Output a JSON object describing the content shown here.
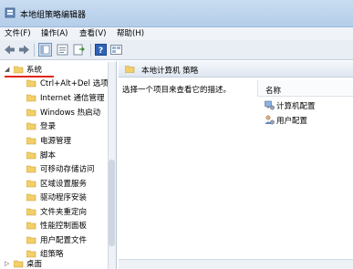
{
  "window": {
    "title": "本地组策略编辑器"
  },
  "menu": {
    "items": [
      "文件(F)",
      "操作(A)",
      "查看(V)",
      "帮助(H)"
    ]
  },
  "tree": {
    "root_label": "系统",
    "children": [
      "Ctrl+Alt+Del 选项",
      "Internet 通信管理",
      "Windows 热启动",
      "登录",
      "电源管理",
      "脚本",
      "可移动存储访问",
      "区域设置服务",
      "驱动程序安装",
      "文件夹重定向",
      "性能控制面板",
      "用户配置文件",
      "组策略"
    ],
    "sibling_label": "桌面"
  },
  "right": {
    "header_title": "本地计算机 策略",
    "description": "选择一个项目来查看它的描述。",
    "column_name": "名称",
    "items": [
      "计算机配置",
      "用户配置"
    ]
  },
  "colors": {
    "accent_red": "#e0261b",
    "folder": "#f3cf6a"
  }
}
